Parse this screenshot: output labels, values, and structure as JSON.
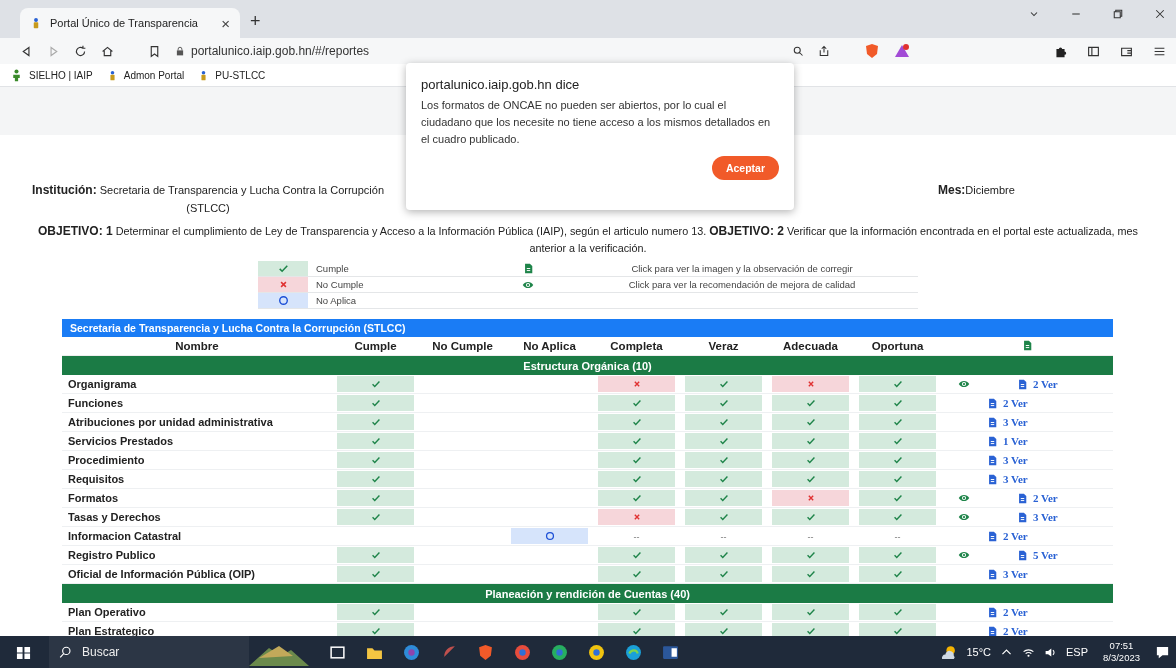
{
  "browser": {
    "tab": {
      "title": "Portal Único de Transparencia",
      "close": "×",
      "selected": true
    },
    "new_tab": "+",
    "url": "portalunico.iaip.gob.hn/#/reportes",
    "bookmarks": [
      "SIELHO | IAIP",
      "Admon Portal",
      "PU-STLCC"
    ]
  },
  "dialog": {
    "title": "portalunico.iaip.gob.hn dice",
    "message": "Los formatos de ONCAE no pueden ser abiertos, por lo cual el ciudadano que los necesite no tiene acceso a los mismos detallados en el cuadro publicado.",
    "button": "Aceptar"
  },
  "header": {
    "institution_label": "Institución:",
    "institution": "Secretaria de Transparencia y Lucha Contra la Corrupción (STLCC)",
    "month_label": "Mes:",
    "month": "Diciembre",
    "objective": "**OBJETIVO: 1** Determinar el cumplimiento de Ley de Transparencia y Acceso a la Información Pública (IAIP), según el articulo numero 13. **OBJETIVO: 2** Verificar que la información encontrada en el portal este actualizada, mes anterior a la verificación."
  },
  "legend": [
    {
      "kind": "ok",
      "label": "Cumple"
    },
    {
      "kind": "fail",
      "label": "No Cumple"
    },
    {
      "kind": "na",
      "label": "No Aplica"
    }
  ],
  "legend_actions": [
    {
      "kind": "file",
      "label": "Click para ver la imagen y la observación de corregir"
    },
    {
      "kind": "eye",
      "label": "Click para ver la recomendación de mejora de calidad"
    }
  ],
  "table": {
    "title": "Secretaria de Transparencia y Lucha Contra la Corrupción (STLCC)",
    "columns": [
      "Nombre",
      "Cumple",
      "No Cumple",
      "No Aplica",
      "Completa",
      "Veraz",
      "Adecuada",
      "Oportuna"
    ],
    "sections": [
      {
        "title": "Estructura Orgánica (10)",
        "rows": [
          {
            "name": "Organigrama",
            "kind": "cumple",
            "checks": [
              {
                "kind": "fail"
              },
              {
                "kind": "ok"
              },
              {
                "kind": "fail"
              },
              {
                "kind": "ok"
              }
            ],
            "eye": true,
            "docs": "2 Ver"
          },
          {
            "name": "Funciones",
            "kind": "cumple",
            "checks": [
              {
                "kind": "ok"
              },
              {
                "kind": "ok"
              },
              {
                "kind": "ok"
              },
              {
                "kind": "ok"
              }
            ],
            "eye": false,
            "docs": "2 Ver"
          },
          {
            "name": "Atribuciones por unidad administrativa",
            "kind": "cumple",
            "checks": [
              {
                "kind": "ok"
              },
              {
                "kind": "ok"
              },
              {
                "kind": "ok"
              },
              {
                "kind": "ok"
              }
            ],
            "eye": false,
            "docs": "3 Ver"
          },
          {
            "name": "Servicios Prestados",
            "kind": "cumple",
            "checks": [
              {
                "kind": "ok"
              },
              {
                "kind": "ok"
              },
              {
                "kind": "ok"
              },
              {
                "kind": "ok"
              }
            ],
            "eye": false,
            "docs": "1 Ver"
          },
          {
            "name": "Procedimiento",
            "kind": "cumple",
            "checks": [
              {
                "kind": "ok"
              },
              {
                "kind": "ok"
              },
              {
                "kind": "ok"
              },
              {
                "kind": "ok"
              }
            ],
            "eye": false,
            "docs": "3 Ver"
          },
          {
            "name": "Requisitos",
            "kind": "cumple",
            "checks": [
              {
                "kind": "ok"
              },
              {
                "kind": "ok"
              },
              {
                "kind": "ok"
              },
              {
                "kind": "ok"
              }
            ],
            "eye": false,
            "docs": "3 Ver"
          },
          {
            "name": "Formatos",
            "kind": "cumple",
            "checks": [
              {
                "kind": "ok"
              },
              {
                "kind": "ok"
              },
              {
                "kind": "fail"
              },
              {
                "kind": "ok"
              }
            ],
            "eye": true,
            "docs": "2 Ver"
          },
          {
            "name": "Tasas y Derechos",
            "kind": "cumple",
            "checks": [
              {
                "kind": "fail"
              },
              {
                "kind": "ok"
              },
              {
                "kind": "ok"
              },
              {
                "kind": "ok"
              }
            ],
            "eye": true,
            "docs": "3 Ver"
          },
          {
            "name": "Informacion Catastral",
            "kind": "no_aplica",
            "checks": [
              {
                "kind": "dash",
                "text": "--"
              },
              {
                "kind": "dash",
                "text": "--"
              },
              {
                "kind": "dash",
                "text": "--"
              },
              {
                "kind": "dash",
                "text": "--"
              }
            ],
            "eye": false,
            "docs": "2 Ver"
          },
          {
            "name": "Registro Publico",
            "kind": "cumple",
            "checks": [
              {
                "kind": "ok"
              },
              {
                "kind": "ok"
              },
              {
                "kind": "ok"
              },
              {
                "kind": "ok"
              }
            ],
            "eye": true,
            "docs": "5 Ver"
          },
          {
            "name": "Oficial de Información Pública (OIP)",
            "kind": "cumple",
            "checks": [
              {
                "kind": "ok"
              },
              {
                "kind": "ok"
              },
              {
                "kind": "ok"
              },
              {
                "kind": "ok"
              }
            ],
            "eye": false,
            "docs": "3 Ver"
          }
        ]
      },
      {
        "title": "Planeación y rendición de Cuentas (40)",
        "rows": [
          {
            "name": "Plan Operativo",
            "kind": "cumple",
            "checks": [
              {
                "kind": "ok"
              },
              {
                "kind": "ok"
              },
              {
                "kind": "ok"
              },
              {
                "kind": "ok"
              }
            ],
            "eye": false,
            "docs": "2 Ver"
          },
          {
            "name": "Plan Estrategico",
            "kind": "cumple",
            "checks": [
              {
                "kind": "ok"
              },
              {
                "kind": "ok"
              },
              {
                "kind": "ok"
              },
              {
                "kind": "ok"
              }
            ],
            "eye": false,
            "docs": "2 Ver"
          }
        ]
      }
    ]
  },
  "taskbar": {
    "search": "Buscar",
    "weather": "15°C",
    "language": "ESP",
    "time": "07:51",
    "date": "8/3/2023"
  }
}
